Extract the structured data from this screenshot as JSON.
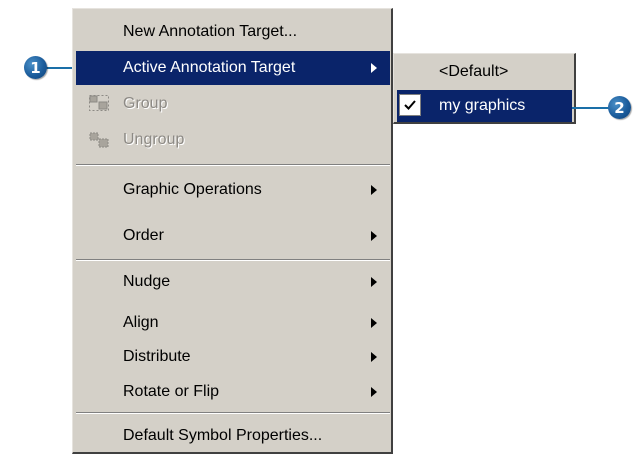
{
  "menu": {
    "items": [
      {
        "label": "New Annotation Target...",
        "state": "normal",
        "submenu": false
      },
      {
        "label": "Active Annotation Target",
        "state": "highlighted",
        "submenu": true
      },
      {
        "label": "Group",
        "state": "disabled",
        "submenu": false,
        "icon": "group-icon"
      },
      {
        "label": "Ungroup",
        "state": "disabled",
        "submenu": false,
        "icon": "ungroup-icon"
      },
      {
        "label": "Graphic Operations",
        "state": "normal",
        "submenu": true
      },
      {
        "label": "Order",
        "state": "normal",
        "submenu": true
      },
      {
        "label": "Nudge",
        "state": "normal",
        "submenu": true
      },
      {
        "label": "Align",
        "state": "normal",
        "submenu": true
      },
      {
        "label": "Distribute",
        "state": "normal",
        "submenu": true
      },
      {
        "label": "Rotate or Flip",
        "state": "normal",
        "submenu": true
      },
      {
        "label": "Default Symbol Properties...",
        "state": "normal",
        "submenu": false
      }
    ]
  },
  "submenu": {
    "items": [
      {
        "label": "<Default>",
        "checked": false,
        "state": "normal"
      },
      {
        "label": "my graphics",
        "checked": true,
        "state": "highlighted"
      }
    ]
  },
  "callouts": [
    {
      "number": "1"
    },
    {
      "number": "2"
    }
  ],
  "colors": {
    "menu_bg": "#d4d0c8",
    "highlight": "#0a246a",
    "callout": "#1c5d9c"
  }
}
